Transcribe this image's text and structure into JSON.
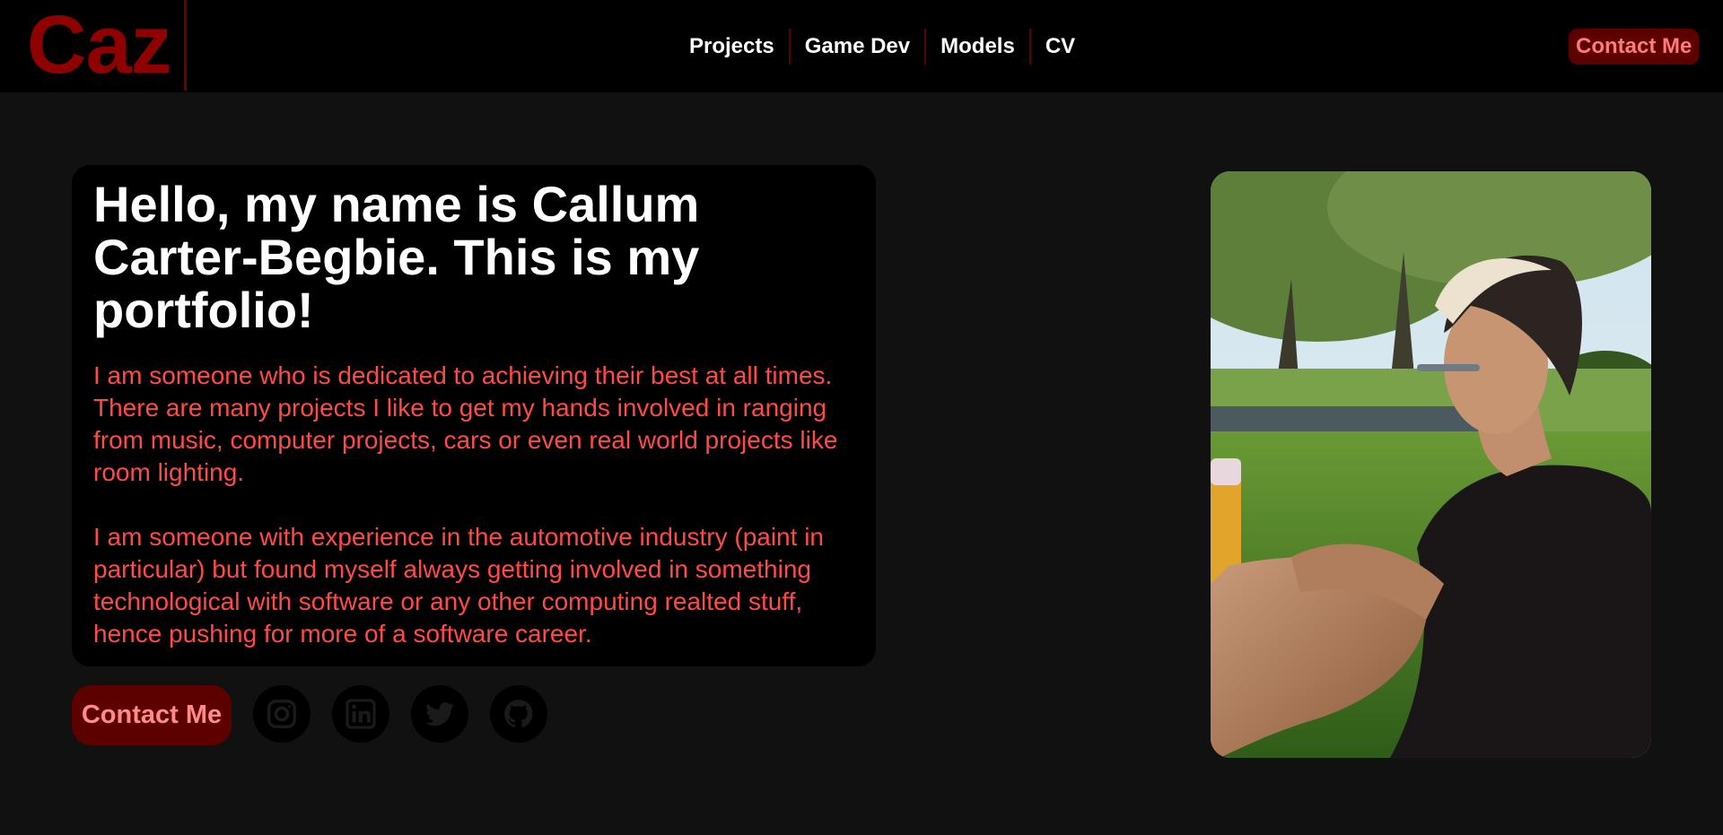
{
  "header": {
    "logo": "Caz",
    "nav": [
      "Projects",
      "Game Dev",
      "Models",
      "CV"
    ],
    "contact_label": "Contact Me"
  },
  "hero": {
    "title": "Hello, my name is Callum Carter-Begbie. This is my portfolio!",
    "paragraphs": [
      "I am someone who is dedicated to achieving their best at all times. There are many projects I like to get my hands involved in ranging from music, computer projects, cars or even real world projects like room lighting.",
      "I am someone with experience in the automotive industry (paint in particular) but found myself always getting involved in something technological with software or any other computing realted stuff, hence pushing for more of a software career."
    ]
  },
  "actions": {
    "contact_label": "Contact Me",
    "social_icons": [
      "instagram-icon",
      "linkedin-icon",
      "twitter-icon",
      "github-icon"
    ]
  },
  "colors": {
    "accent": "#8f0000",
    "button_bg": "#5c0000",
    "button_text": "#ff8a8a",
    "body_text": "#ff4a4a",
    "page_bg": "#111111",
    "card_bg": "#000000"
  }
}
